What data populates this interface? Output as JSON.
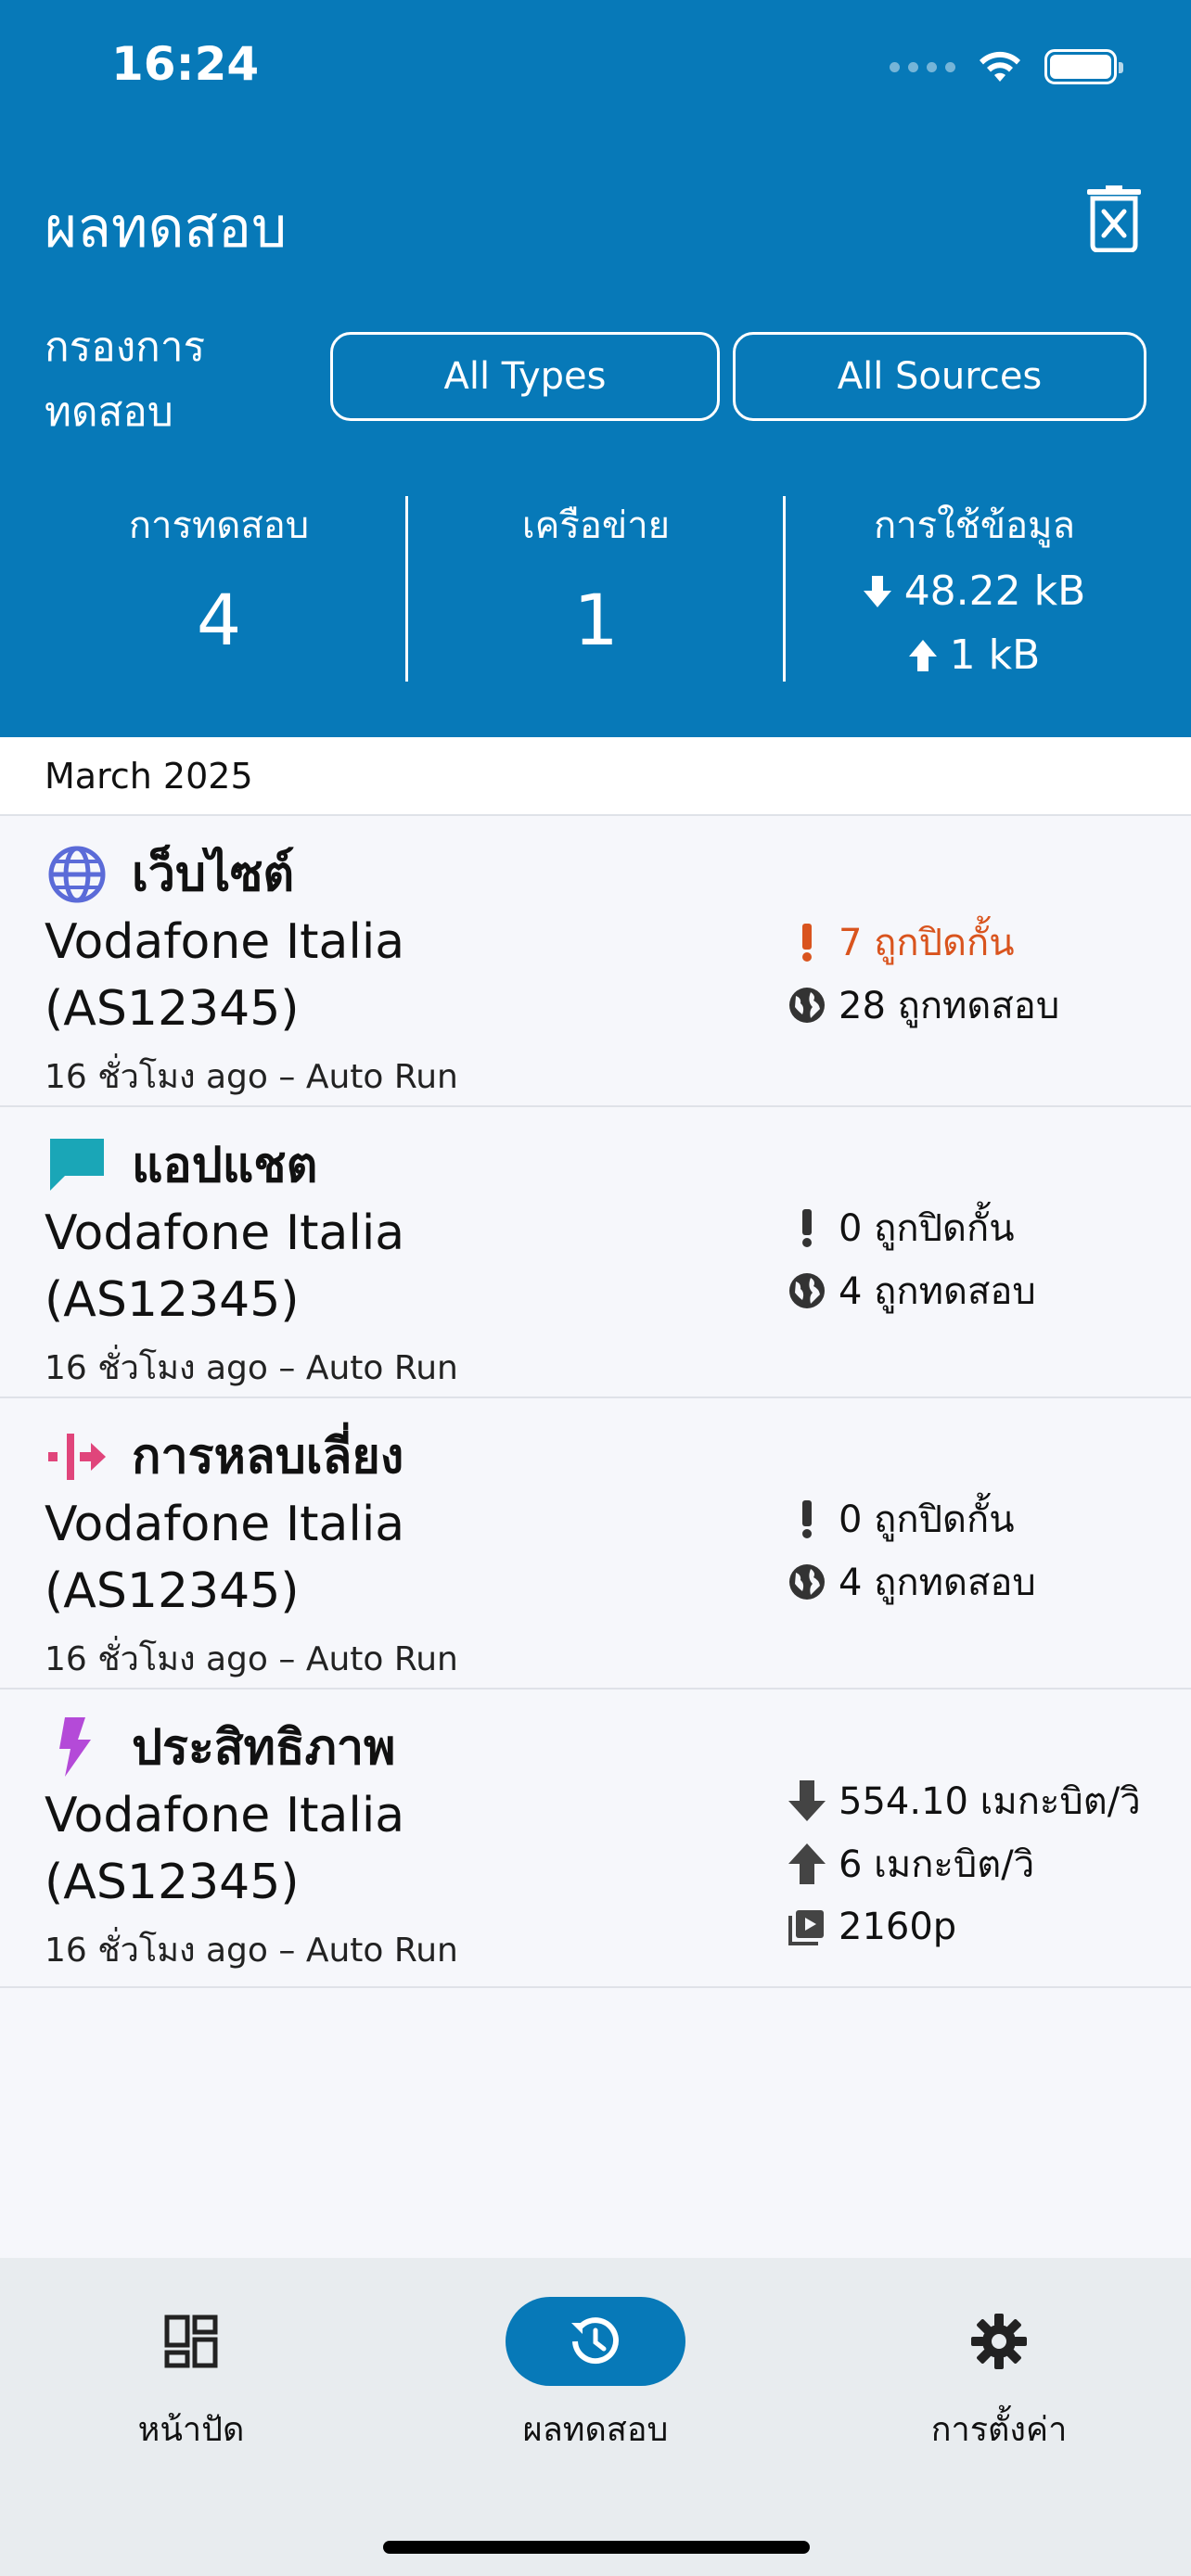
{
  "status_bar": {
    "time": "16:24"
  },
  "header": {
    "title": "ผลทดสอบ",
    "filter_label": "กรองการทดสอบ",
    "filter_types": "All Types",
    "filter_sources": "All Sources"
  },
  "stats": {
    "tests_label": "การทดสอบ",
    "tests_value": "4",
    "networks_label": "เครือข่าย",
    "networks_value": "1",
    "data_label": "การใช้ข้อมูล",
    "download": "48.22 kB",
    "upload": "1 kB"
  },
  "month": "March 2025",
  "rows": [
    {
      "title": "เว็บไซต์",
      "network_line1": "Vodafone Italia",
      "network_line2": "(AS12345)",
      "meta": "16 ชั่วโมง ago – Auto Run",
      "stat1": "7 ถูกปิดกั้น",
      "stat2": "28 ถูกทดสอบ",
      "icon": "globe-icon",
      "icon_color": "#5b6bd8"
    },
    {
      "title": "แอปแชต",
      "network_line1": "Vodafone Italia",
      "network_line2": "(AS12345)",
      "meta": "16 ชั่วโมง ago – Auto Run",
      "stat1": "0 ถูกปิดกั้น",
      "stat2": "4 ถูกทดสอบ",
      "icon": "chat-icon",
      "icon_color": "#1aa6b7"
    },
    {
      "title": "การหลบเลี่ยง",
      "network_line1": "Vodafone Italia",
      "network_line2": "(AS12345)",
      "meta": "16 ชั่วโมง ago – Auto Run",
      "stat1": "0 ถูกปิดกั้น",
      "stat2": "4 ถูกทดสอบ",
      "icon": "circumvention-icon",
      "icon_color": "#e0457b"
    },
    {
      "title": "ประสิทธิภาพ",
      "network_line1": "Vodafone Italia",
      "network_line2": "(AS12345)",
      "meta": "16 ชั่วโมง ago – Auto Run",
      "stat1": "554.10 เมกะบิต/วิ",
      "stat2": "6 เมกะบิต/วิ",
      "stat3": "2160p",
      "icon": "lightning-icon",
      "icon_color": "#b44ad8"
    }
  ],
  "colors": {
    "header_bg": "#0779b8",
    "blocked_alert": "#d9541e"
  },
  "nav": {
    "dashboard": "หน้าปัด",
    "results": "ผลทดสอบ",
    "settings": "การตั้งค่า"
  }
}
